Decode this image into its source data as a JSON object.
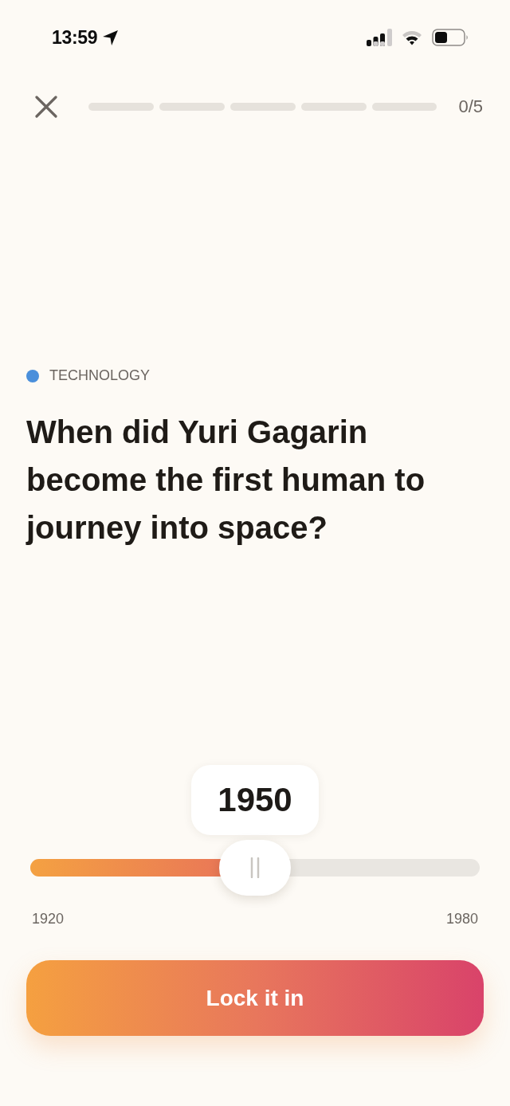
{
  "status_bar": {
    "time": "13:59"
  },
  "top_bar": {
    "progress": {
      "segments": [
        {
          "completed": false
        },
        {
          "completed": false
        },
        {
          "completed": false
        },
        {
          "completed": false
        },
        {
          "completed": false
        }
      ],
      "count": "0/5"
    }
  },
  "question": {
    "category": "TECHNOLOGY",
    "text": "When did Yuri Gagarin become the first human to journey into space?"
  },
  "slider": {
    "value": "1950",
    "level": 0.5,
    "min_label": "1920",
    "max_label": "1980"
  },
  "button": {
    "label": "Lock it in"
  }
}
